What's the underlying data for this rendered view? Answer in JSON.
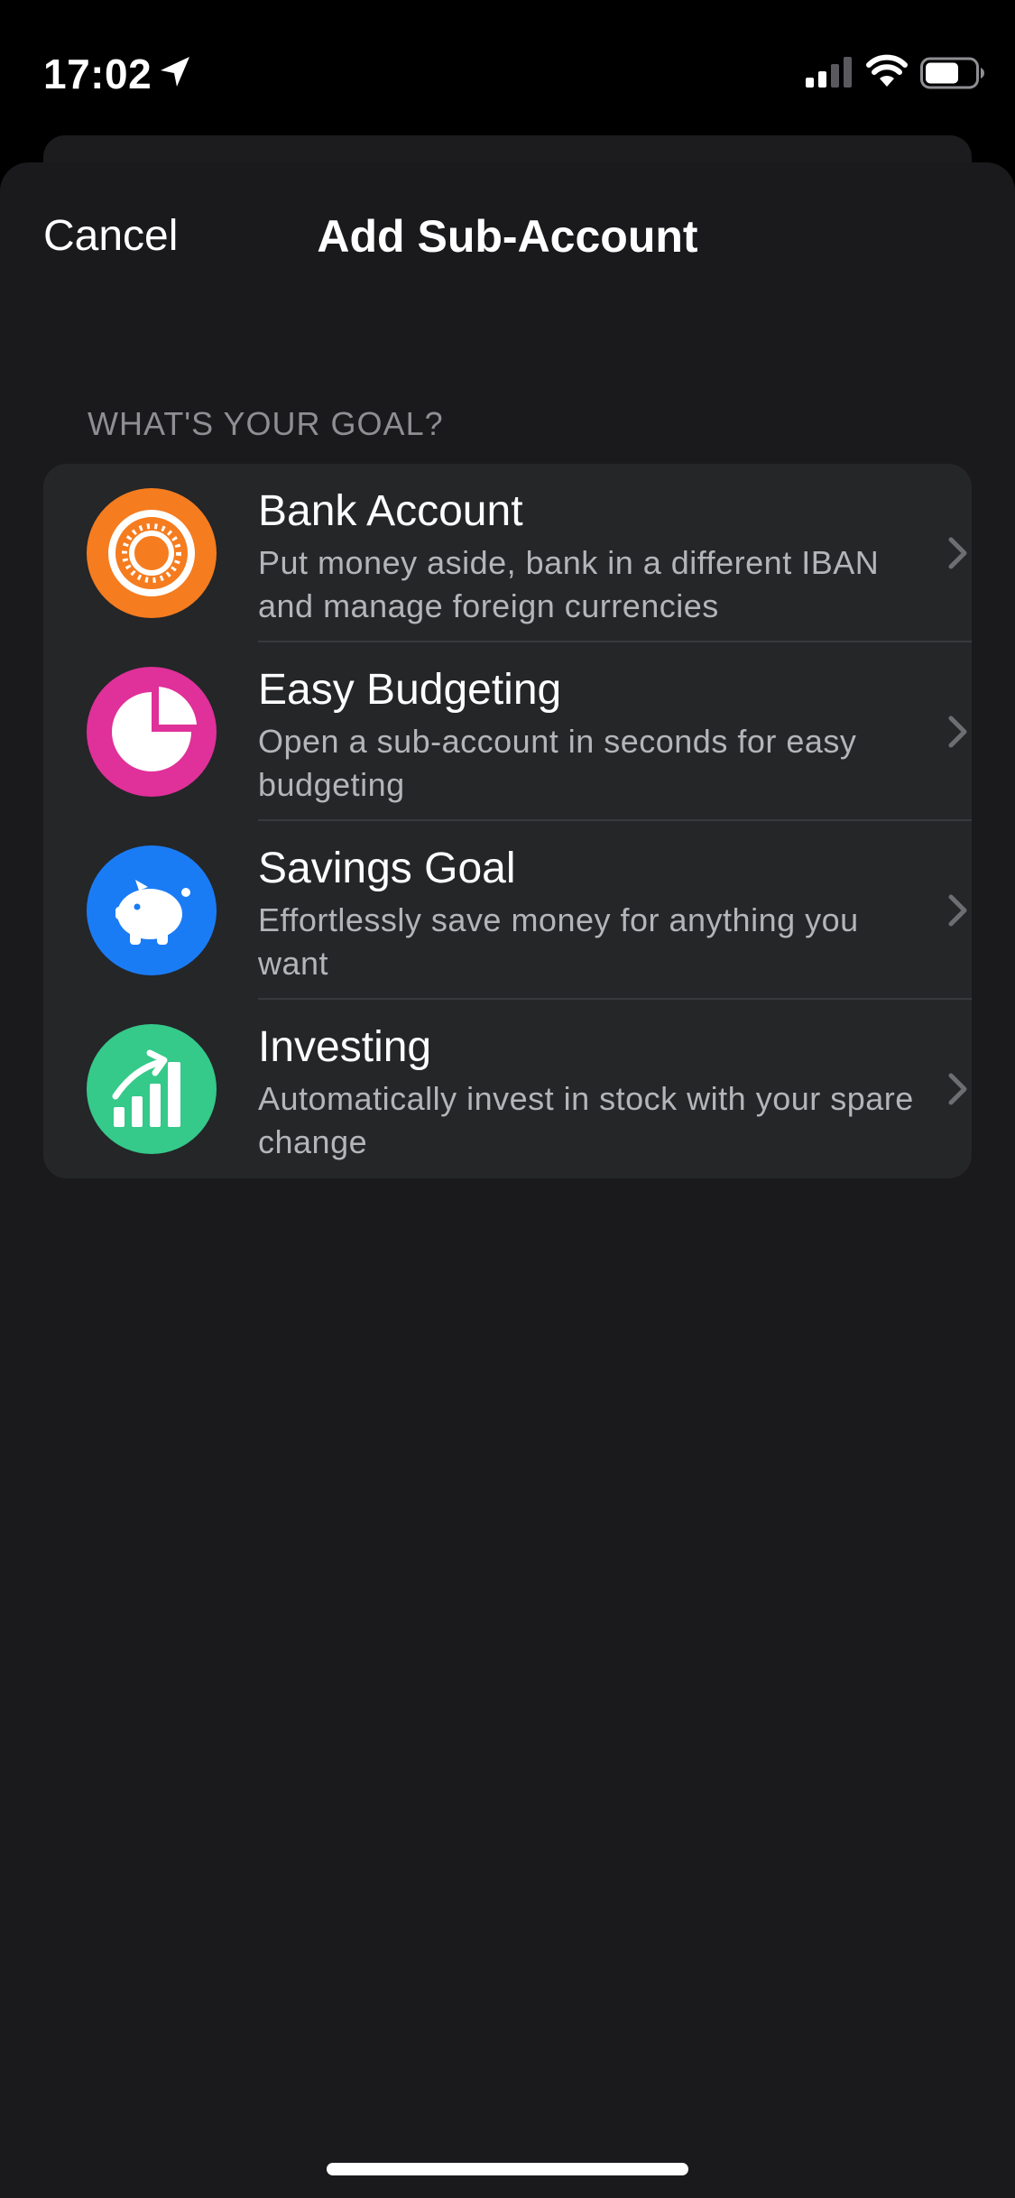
{
  "status_bar": {
    "time": "17:02",
    "icons": [
      "location-arrow-icon",
      "cellular-signal-icon",
      "wifi-icon",
      "battery-icon"
    ]
  },
  "nav": {
    "cancel_label": "Cancel",
    "title": "Add Sub-Account"
  },
  "section": {
    "header": "WHAT'S YOUR GOAL?"
  },
  "options": [
    {
      "title": "Bank Account",
      "description": "Put money aside, bank in a different IBAN and manage foreign currencies",
      "icon": "coin-icon",
      "color": "#f57c1f"
    },
    {
      "title": "Easy Budgeting",
      "description": "Open a sub-account in seconds for easy budgeting",
      "icon": "pie-chart-icon",
      "color": "#e0309a"
    },
    {
      "title": "Savings Goal",
      "description": "Effortlessly save money for anything you want",
      "icon": "piggy-bank-icon",
      "color": "#1a7cf5"
    },
    {
      "title": "Investing",
      "description": "Automatically invest in stock with your spare change",
      "icon": "growth-chart-icon",
      "color": "#35c98a"
    }
  ],
  "colors": {
    "background": "#000000",
    "sheet": "#1a1a1c",
    "list_background": "#242628",
    "secondary_text": "#b4b5b8",
    "section_header": "#8e8e93"
  }
}
